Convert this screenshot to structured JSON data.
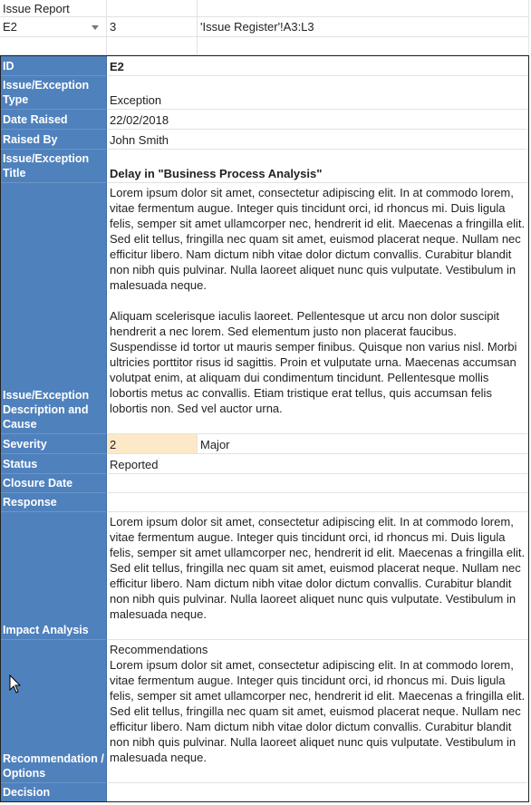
{
  "header": {
    "title": "Issue Report",
    "cell_ref": "E2",
    "row_count": "3",
    "range_ref": "'Issue Register'!A3:L3"
  },
  "fields": {
    "id": {
      "label": "ID",
      "value": "E2"
    },
    "type": {
      "label": "Issue/Exception Type",
      "value": "Exception"
    },
    "date_raised": {
      "label": "Date Raised",
      "value": "22/02/2018"
    },
    "raised_by": {
      "label": "Raised By",
      "value": "John Smith"
    },
    "title": {
      "label": "Issue/Exception Title",
      "value": "Delay in \"Business Process Analysis\""
    },
    "description": {
      "label": "Issue/Exception Description and Cause",
      "value": "Lorem ipsum dolor sit amet, consectetur adipiscing elit. In at commodo lorem, vitae fermentum augue. Integer quis tincidunt orci, id rhoncus mi. Duis ligula felis, semper sit amet ullamcorper nec, hendrerit id elit. Maecenas a fringilla elit. Sed elit tellus, fringilla nec quam sit amet, euismod placerat neque. Nullam nec efficitur libero. Nam dictum nibh vitae dolor dictum convallis. Curabitur blandit non nibh quis pulvinar. Nulla laoreet aliquet nunc quis vulputate. Vestibulum in malesuada neque.\n\nAliquam scelerisque iaculis laoreet. Pellentesque ut arcu non dolor suscipit hendrerit a nec lorem. Sed elementum justo non placerat faucibus. Suspendisse id tortor ut mauris semper finibus. Quisque non varius nisl. Morbi ultricies porttitor risus id sagittis. Proin et vulputate urna. Maecenas accumsan volutpat enim, at aliquam dui condimentum tincidunt. Pellentesque mollis lobortis metus ac convallis. Etiam tristique erat tellus, quis accumsan felis lobortis non. Sed vel auctor urna."
    },
    "severity": {
      "label": "Severity",
      "value": "2",
      "text": "Major"
    },
    "status": {
      "label": "Status",
      "value": "Reported"
    },
    "closure_date": {
      "label": "Closure Date",
      "value": ""
    },
    "response": {
      "label": "Response",
      "value": ""
    },
    "impact": {
      "label": "Impact Analysis",
      "value": "Lorem ipsum dolor sit amet, consectetur adipiscing elit. In at commodo lorem, vitae fermentum augue. Integer quis tincidunt orci, id rhoncus mi. Duis ligula felis, semper sit amet ullamcorper nec, hendrerit id elit. Maecenas a fringilla elit. Sed elit tellus, fringilla nec quam sit amet, euismod placerat neque. Nullam nec efficitur libero. Nam dictum nibh vitae dolor dictum convallis. Curabitur blandit non nibh quis pulvinar. Nulla laoreet aliquet nunc quis vulputate. Vestibulum in malesuada neque."
    },
    "recommendation": {
      "label": "Recommendation / Options",
      "value": "Recommendations\nLorem ipsum dolor sit amet, consectetur adipiscing elit. In at commodo lorem, vitae fermentum augue. Integer quis tincidunt orci, id rhoncus mi. Duis ligula felis, semper sit amet ullamcorper nec, hendrerit id elit. Maecenas a fringilla elit. Sed elit tellus, fringilla nec quam sit amet, euismod placerat neque. Nullam nec efficitur libero. Nam dictum nibh vitae dolor dictum convallis. Curabitur blandit non nibh quis pulvinar. Nulla laoreet aliquet nunc quis vulputate. Vestibulum in malesuada neque."
    },
    "decision": {
      "label": "Decision",
      "value": ""
    }
  },
  "icons": {
    "dropdown": "chevron-down-icon",
    "cursor": "mouse-pointer-icon"
  },
  "colors": {
    "label_bg": "#4f81bd",
    "severity_bg": "#fde9c7"
  }
}
